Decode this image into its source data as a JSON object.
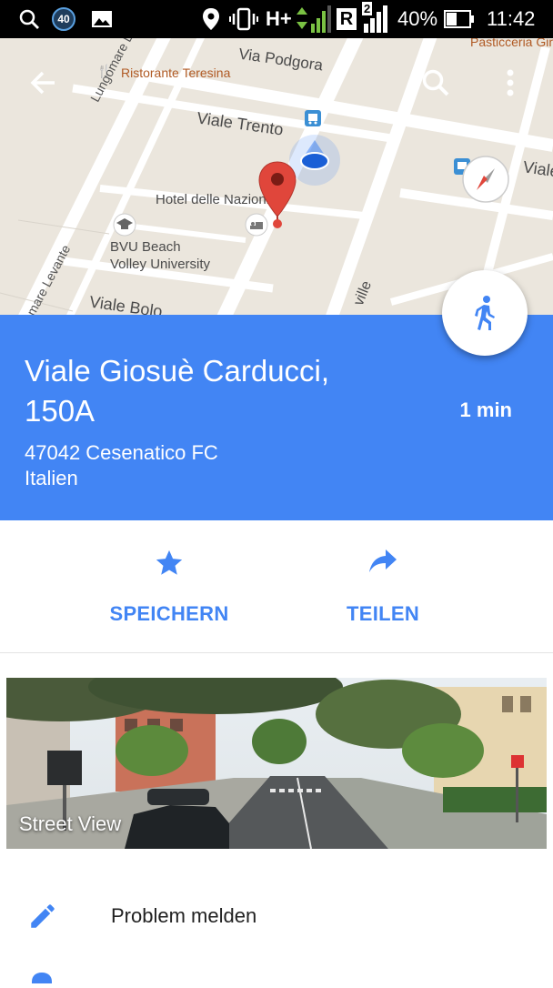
{
  "status_bar": {
    "notification_badge": "40",
    "network_type": "H+",
    "roaming": "R",
    "sim_slot": "2",
    "battery": "40%",
    "time": "11:42"
  },
  "map": {
    "labels": {
      "restaurant": "Ristorante Teresina",
      "pasticceria": "Pasticceria Giri",
      "via_podgora": "Via Podgora",
      "lungomare_levante": "Lungomare Levante",
      "viale_trento": "Viale Trento",
      "viale_right": "Viale",
      "hotel": "Hotel delle Nazioni",
      "bvu_line1": "BVU Beach",
      "bvu_line2": "Volley University",
      "mare_levante": "mare Levante",
      "viale_bologna": "Viale Bolo",
      "ville": "ville"
    },
    "icons": {
      "back": "arrow-back-icon",
      "search": "search-icon",
      "more": "more-vert-icon",
      "compass": "compass-icon",
      "pin": "map-pin-icon",
      "location": "my-location-icon"
    }
  },
  "place": {
    "title": "Viale Giosuè Carducci, 150A",
    "travel_time": "1 min",
    "address_line1": "47042 Cesenatico FC",
    "address_line2": "Italien",
    "travel_mode_icon": "walking-icon"
  },
  "actions": {
    "save": {
      "label": "SPEICHERN",
      "icon": "star-icon"
    },
    "share": {
      "label": "TEILEN",
      "icon": "share-icon"
    }
  },
  "street_view": {
    "label": "Street View"
  },
  "report": {
    "label": "Problem melden",
    "icon": "edit-pencil-icon"
  },
  "colors": {
    "accent": "#4285f4",
    "map_background": "#ebe6dd",
    "pin": "#db4437",
    "status_bar": "#000000"
  }
}
